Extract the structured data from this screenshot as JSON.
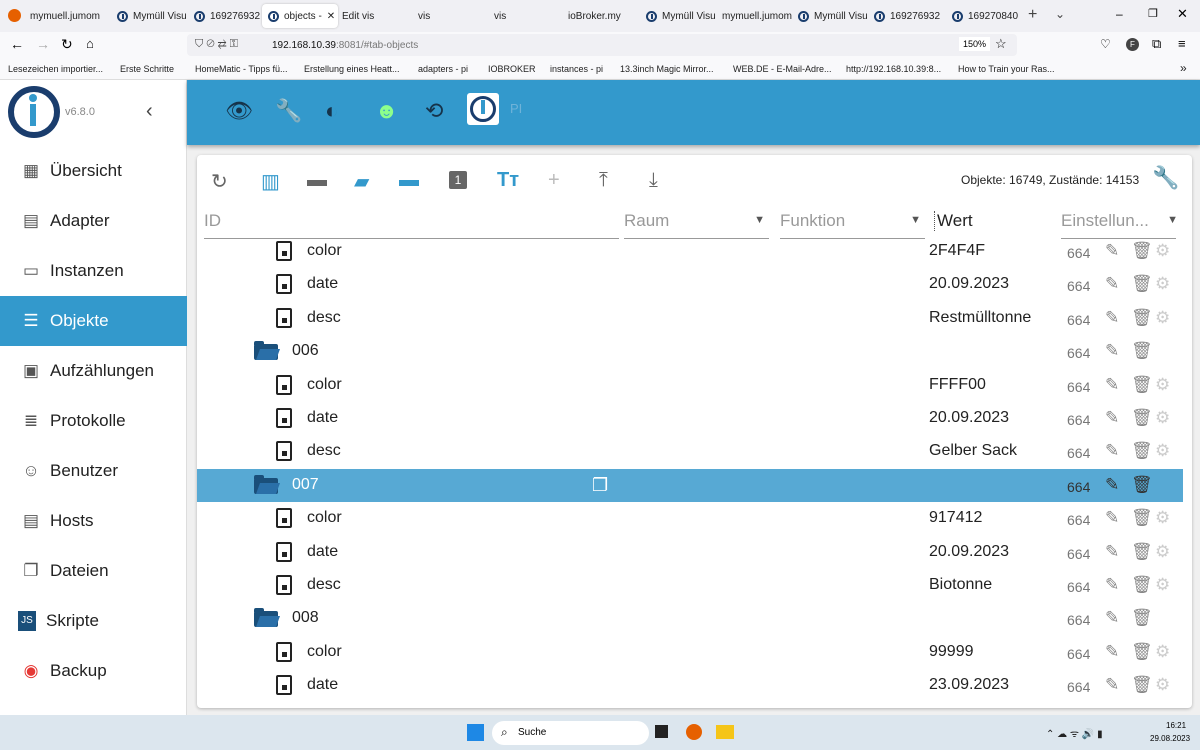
{
  "browser": {
    "tabs": [
      "mymuell.jumom",
      "Mymüll Visu",
      "169276932",
      "objects -",
      "Edit vis",
      "vis",
      "vis",
      "ioBroker.my",
      "Mymüll Visu",
      "mymuell.jumom",
      "Mymüll Visu",
      "169276932",
      "169270840"
    ],
    "active_tab": 3,
    "url_host": "192.168.10.39",
    "url_rest": ":8081/#tab-objects",
    "zoom": "150%",
    "bookmarks": [
      "Lesezeichen importier...",
      "Erste Schritte",
      "HomeMatic - Tipps fü...",
      "Erstellung eines Heatt...",
      "adapters - pi",
      "IOBROKER",
      "instances - pi",
      "13.3inch Magic Mirror...",
      "WEB.DE - E-Mail-Adre...",
      "http://192.168.10.39:8...",
      "How to Train your Ras..."
    ]
  },
  "sidebar": {
    "version": "v6.8.0",
    "items": [
      {
        "label": "Übersicht",
        "icon": "grid-icon"
      },
      {
        "label": "Adapter",
        "icon": "store-icon"
      },
      {
        "label": "Instanzen",
        "icon": "instances-icon"
      },
      {
        "label": "Objekte",
        "icon": "list-icon",
        "selected": true
      },
      {
        "label": "Aufzählungen",
        "icon": "enum-icon"
      },
      {
        "label": "Protokolle",
        "icon": "log-icon"
      },
      {
        "label": "Benutzer",
        "icon": "user-icon"
      },
      {
        "label": "Hosts",
        "icon": "hosts-icon"
      },
      {
        "label": "Dateien",
        "icon": "files-icon"
      },
      {
        "label": "Skripte",
        "icon": "js-icon"
      },
      {
        "label": "Backup",
        "icon": "backup-icon"
      }
    ]
  },
  "header": {
    "host": "PI"
  },
  "objects": {
    "stats": "Objekte: 16749, Zustände: 14153",
    "columns": {
      "id": "ID",
      "room": "Raum",
      "function": "Funktion",
      "value": "Wert",
      "settings": "Einstellun..."
    },
    "rows": [
      {
        "name": "color",
        "type": "state",
        "value": "2F4F4F",
        "acl": "664"
      },
      {
        "name": "date",
        "type": "state",
        "value": "20.09.2023",
        "acl": "664"
      },
      {
        "name": "desc",
        "type": "state",
        "value": "Restmülltonne",
        "acl": "664"
      },
      {
        "name": "006",
        "type": "folder",
        "value": "",
        "acl": "664"
      },
      {
        "name": "color",
        "type": "state",
        "value": "FFFF00",
        "acl": "664"
      },
      {
        "name": "date",
        "type": "state",
        "value": "20.09.2023",
        "acl": "664"
      },
      {
        "name": "desc",
        "type": "state",
        "value": "Gelber Sack",
        "acl": "664"
      },
      {
        "name": "007",
        "type": "folder",
        "value": "",
        "acl": "664",
        "selected": true
      },
      {
        "name": "color",
        "type": "state",
        "value": "917412",
        "acl": "664"
      },
      {
        "name": "date",
        "type": "state",
        "value": "20.09.2023",
        "acl": "664"
      },
      {
        "name": "desc",
        "type": "state",
        "value": "Biotonne",
        "acl": "664"
      },
      {
        "name": "008",
        "type": "folder",
        "value": "",
        "acl": "664"
      },
      {
        "name": "color",
        "type": "state",
        "value": "99999",
        "acl": "664"
      },
      {
        "name": "date",
        "type": "state",
        "value": "23.09.2023",
        "acl": "664"
      }
    ]
  },
  "taskbar": {
    "search": "Suche",
    "time": "16:21",
    "date": "29.08.2023"
  },
  "colors": {
    "accent": "#3399cc",
    "selected_row": "#57a9d4",
    "folder": "#1a4f7a"
  }
}
